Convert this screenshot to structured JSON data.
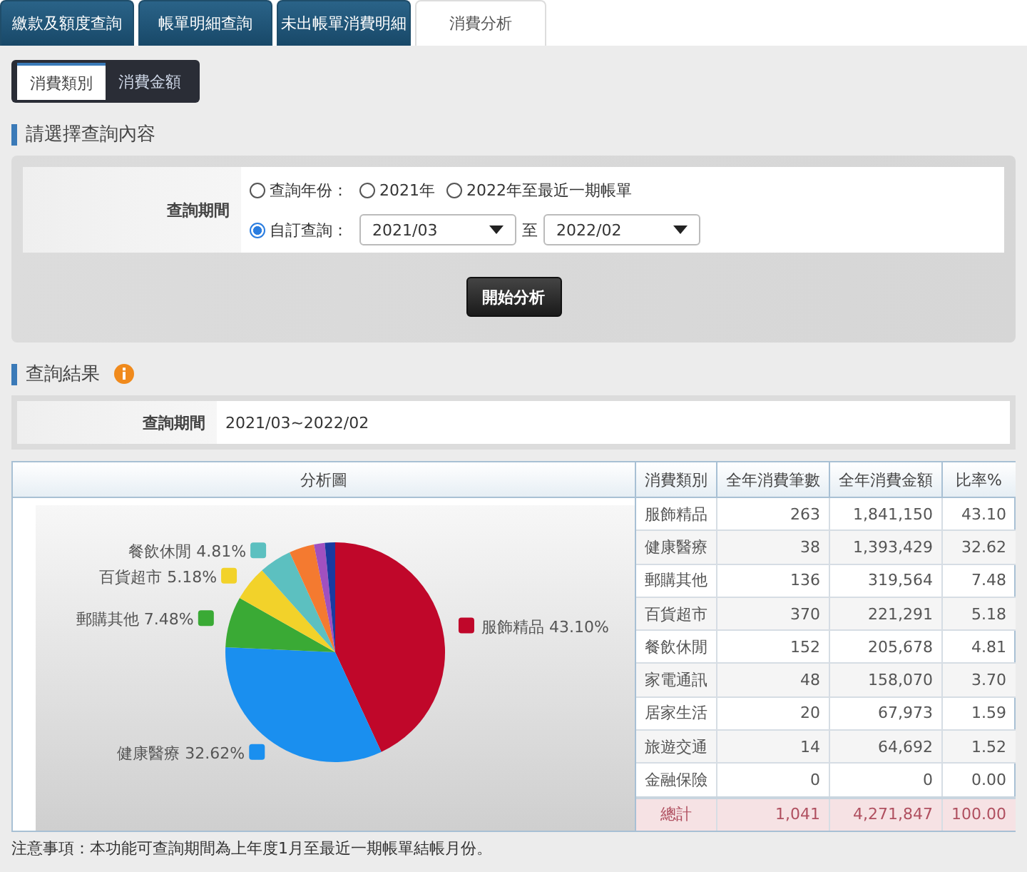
{
  "tabs": [
    {
      "label": "繳款及額度查詢",
      "selected": false
    },
    {
      "label": "帳單明細查詢",
      "selected": false
    },
    {
      "label": "未出帳單消費明細",
      "selected": false
    },
    {
      "label": "消費分析",
      "selected": true
    }
  ],
  "subtabs": [
    {
      "label": "消費類別",
      "selected": true
    },
    {
      "label": "消費金額",
      "selected": false
    }
  ],
  "query": {
    "title": "請選擇查詢內容",
    "period_label": "查詢期間",
    "options": [
      {
        "label": "查詢年份：",
        "selected": false
      },
      {
        "label": "2021年",
        "selected": false
      },
      {
        "label": "2022年至最近一期帳單",
        "selected": false
      },
      {
        "label": "自訂查詢：",
        "selected": true
      }
    ],
    "from": "2021/03",
    "separator": "至",
    "to": "2022/02",
    "button": "開始分析"
  },
  "result": {
    "title": "查詢結果",
    "period_label": "查詢期間",
    "period": "2021/03~2022/02"
  },
  "table": {
    "chart_heading": "分析圖",
    "columns": [
      "消費類別",
      "全年消費筆數",
      "全年消費金額",
      "比率%"
    ],
    "rows": [
      [
        "服飾精品",
        "263",
        "1,841,150",
        "43.10"
      ],
      [
        "健康醫療",
        "38",
        "1,393,429",
        "32.62"
      ],
      [
        "郵購其他",
        "136",
        "319,564",
        "7.48"
      ],
      [
        "百貨超市",
        "370",
        "221,291",
        "5.18"
      ],
      [
        "餐飲休閒",
        "152",
        "205,678",
        "4.81"
      ],
      [
        "家電通訊",
        "48",
        "158,070",
        "3.70"
      ],
      [
        "居家生活",
        "20",
        "67,973",
        "1.59"
      ],
      [
        "旅遊交通",
        "14",
        "64,692",
        "1.52"
      ],
      [
        "金融保險",
        "0",
        "0",
        "0.00"
      ]
    ],
    "total": [
      "總計",
      "1,041",
      "4,271,847",
      "100.00"
    ],
    "chart_data": {
      "type": "pie",
      "values": [
        43.1,
        32.62,
        7.48,
        5.18,
        4.81,
        3.7,
        1.59,
        1.52
      ],
      "colors": [
        "#c0072a",
        "#1a8fef",
        "#3aaa35",
        "#f2d22a",
        "#5cc0c0",
        "#f47a30",
        "#a050c0",
        "#1a3aa0"
      ],
      "annotations": [
        {
          "text": "服飾精品 43.10%"
        },
        {
          "text": "健康醫療 32.62%"
        },
        {
          "text": "郵購其他 7.48%"
        },
        {
          "text": "百貨超市 5.18%"
        },
        {
          "text": "餐飲休閒 4.81%"
        }
      ]
    }
  },
  "note": "注意事項：本功能可查詢期間為上年度1月至最近一期帳單結帳月份。"
}
